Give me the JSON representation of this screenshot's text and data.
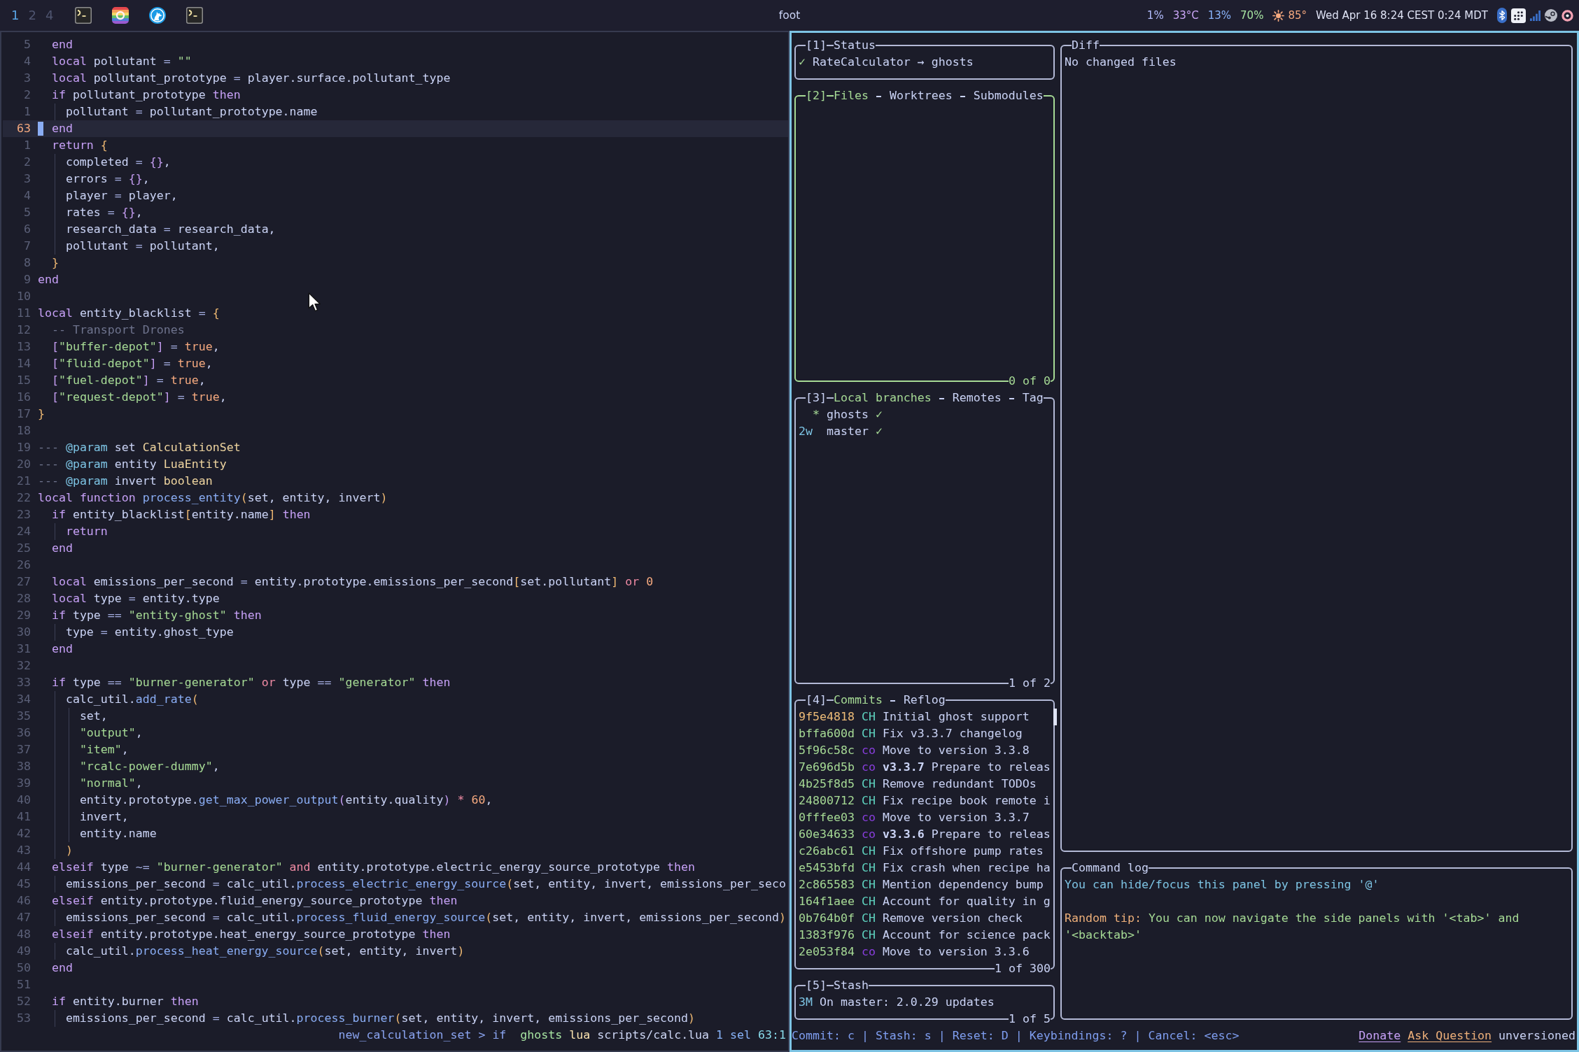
{
  "topbar": {
    "workspaces": [
      {
        "label": "1",
        "selected": true
      },
      {
        "label": "2",
        "selected": false
      },
      {
        "label": "4",
        "selected": false
      }
    ],
    "title": "foot",
    "readings": [
      {
        "text": "1%",
        "color": "#b4befe"
      },
      {
        "text": "33°C",
        "color": "#cba6f7"
      },
      {
        "text": "13%",
        "color": "#89b4fa"
      },
      {
        "text": "70%",
        "color": "#a6e3a1"
      }
    ],
    "weather": "85°",
    "clock": "Wed Apr 16 8:24 CEST 0:24 MDT"
  },
  "editor": {
    "lines": [
      {
        "number": "5",
        "current": false,
        "tokens": [
          {
            "kind": "kw",
            "text": "  end"
          }
        ]
      },
      {
        "number": "4",
        "current": false,
        "tokens": [
          {
            "kind": "kw",
            "text": "  local"
          },
          {
            "kind": "txt",
            "text": " pollutant"
          },
          {
            "kind": "op",
            "text": " = "
          },
          {
            "kind": "str",
            "text": "\"\""
          }
        ]
      },
      {
        "number": "3",
        "current": false,
        "tokens": [
          {
            "kind": "kw",
            "text": "  local"
          },
          {
            "kind": "txt",
            "text": " pollutant_prototype"
          },
          {
            "kind": "op",
            "text": " = "
          },
          {
            "kind": "txt",
            "text": "player.surface.pollutant_type"
          }
        ]
      },
      {
        "number": "2",
        "current": false,
        "tokens": [
          {
            "kind": "kw",
            "text": "  if"
          },
          {
            "kind": "txt",
            "text": " pollutant_prototype "
          },
          {
            "kind": "kw",
            "text": "then"
          }
        ]
      },
      {
        "number": "1",
        "current": false,
        "tokens": [
          {
            "kind": "txt",
            "text": "    pollutant"
          },
          {
            "kind": "op",
            "text": " = "
          },
          {
            "kind": "txt",
            "text": "pollutant_prototype.name"
          }
        ]
      },
      {
        "number": "63",
        "current": true,
        "tokens": [
          {
            "kind": "kw",
            "text": "  end"
          }
        ]
      },
      {
        "number": "1",
        "current": false,
        "tokens": [
          {
            "kind": "kw",
            "text": "  return"
          },
          {
            "kind": "br1",
            "text": " {"
          }
        ]
      },
      {
        "number": "2",
        "current": false,
        "tokens": [
          {
            "kind": "txt",
            "text": "    completed"
          },
          {
            "kind": "op",
            "text": " = "
          },
          {
            "kind": "br2",
            "text": "{}"
          },
          {
            "kind": "txt",
            "text": ","
          }
        ]
      },
      {
        "number": "3",
        "current": false,
        "tokens": [
          {
            "kind": "txt",
            "text": "    errors"
          },
          {
            "kind": "op",
            "text": " = "
          },
          {
            "kind": "br2",
            "text": "{}"
          },
          {
            "kind": "txt",
            "text": ","
          }
        ]
      },
      {
        "number": "4",
        "current": false,
        "tokens": [
          {
            "kind": "txt",
            "text": "    player"
          },
          {
            "kind": "op",
            "text": " = "
          },
          {
            "kind": "txt",
            "text": "player,"
          }
        ]
      },
      {
        "number": "5",
        "current": false,
        "tokens": [
          {
            "kind": "txt",
            "text": "    rates"
          },
          {
            "kind": "op",
            "text": " = "
          },
          {
            "kind": "br2",
            "text": "{}"
          },
          {
            "kind": "txt",
            "text": ","
          }
        ]
      },
      {
        "number": "6",
        "current": false,
        "tokens": [
          {
            "kind": "txt",
            "text": "    research_data"
          },
          {
            "kind": "op",
            "text": " = "
          },
          {
            "kind": "txt",
            "text": "research_data,"
          }
        ]
      },
      {
        "number": "7",
        "current": false,
        "tokens": [
          {
            "kind": "txt",
            "text": "    pollutant"
          },
          {
            "kind": "op",
            "text": " = "
          },
          {
            "kind": "txt",
            "text": "pollutant,"
          }
        ]
      },
      {
        "number": "8",
        "current": false,
        "tokens": [
          {
            "kind": "br1",
            "text": "  }"
          }
        ]
      },
      {
        "number": "9",
        "current": false,
        "tokens": [
          {
            "kind": "kw",
            "text": "end"
          }
        ]
      },
      {
        "number": "10",
        "current": false
      },
      {
        "number": "11",
        "current": false,
        "tokens": [
          {
            "kind": "kw",
            "text": "local"
          },
          {
            "kind": "txt",
            "text": " entity_blacklist"
          },
          {
            "kind": "op",
            "text": " = "
          },
          {
            "kind": "br1",
            "text": "{"
          }
        ]
      },
      {
        "number": "12",
        "current": false,
        "tokens": [
          {
            "kind": "cmt",
            "text": "  -- Transport Drones"
          }
        ]
      },
      {
        "number": "13",
        "current": false,
        "tokens": [
          {
            "kind": "br2",
            "text": "  ["
          },
          {
            "kind": "str",
            "text": "\"buffer-depot\""
          },
          {
            "kind": "br2",
            "text": "]"
          },
          {
            "kind": "op",
            "text": " = "
          },
          {
            "kind": "num",
            "text": "true"
          },
          {
            "kind": "txt",
            "text": ","
          }
        ]
      },
      {
        "number": "14",
        "current": false,
        "tokens": [
          {
            "kind": "br2",
            "text": "  ["
          },
          {
            "kind": "str",
            "text": "\"fluid-depot\""
          },
          {
            "kind": "br2",
            "text": "]"
          },
          {
            "kind": "op",
            "text": " = "
          },
          {
            "kind": "num",
            "text": "true"
          },
          {
            "kind": "txt",
            "text": ","
          }
        ]
      },
      {
        "number": "15",
        "current": false,
        "tokens": [
          {
            "kind": "br2",
            "text": "  ["
          },
          {
            "kind": "str",
            "text": "\"fuel-depot\""
          },
          {
            "kind": "br2",
            "text": "]"
          },
          {
            "kind": "op",
            "text": " = "
          },
          {
            "kind": "num",
            "text": "true"
          },
          {
            "kind": "txt",
            "text": ","
          }
        ]
      },
      {
        "number": "16",
        "current": false,
        "tokens": [
          {
            "kind": "br2",
            "text": "  ["
          },
          {
            "kind": "str",
            "text": "\"request-depot\""
          },
          {
            "kind": "br2",
            "text": "]"
          },
          {
            "kind": "op",
            "text": " = "
          },
          {
            "kind": "num",
            "text": "true"
          },
          {
            "kind": "txt",
            "text": ","
          }
        ]
      },
      {
        "number": "17",
        "current": false,
        "tokens": [
          {
            "kind": "br1",
            "text": "}"
          }
        ]
      },
      {
        "number": "18",
        "current": false
      },
      {
        "number": "19",
        "current": false,
        "tokens": [
          {
            "kind": "cmt",
            "text": "---"
          },
          {
            "kind": "doc",
            "text": " @param"
          },
          {
            "kind": "txt",
            "text": " set "
          },
          {
            "kind": "type",
            "text": "CalculationSet"
          }
        ]
      },
      {
        "number": "20",
        "current": false,
        "tokens": [
          {
            "kind": "cmt",
            "text": "---"
          },
          {
            "kind": "doc",
            "text": " @param"
          },
          {
            "kind": "txt",
            "text": " entity "
          },
          {
            "kind": "type",
            "text": "LuaEntity"
          }
        ]
      },
      {
        "number": "21",
        "current": false,
        "tokens": [
          {
            "kind": "cmt",
            "text": "---"
          },
          {
            "kind": "doc",
            "text": " @param"
          },
          {
            "kind": "txt",
            "text": " invert "
          },
          {
            "kind": "type",
            "text": "boolean"
          }
        ]
      },
      {
        "number": "22",
        "current": false,
        "tokens": [
          {
            "kind": "kw",
            "text": "local function"
          },
          {
            "kind": "fn",
            "text": " process_entity"
          },
          {
            "kind": "br1",
            "text": "("
          },
          {
            "kind": "txt",
            "text": "set, entity, invert"
          },
          {
            "kind": "br1",
            "text": ")"
          }
        ]
      },
      {
        "number": "23",
        "current": false,
        "tokens": [
          {
            "kind": "kw",
            "text": "  if"
          },
          {
            "kind": "txt",
            "text": " entity_blacklist"
          },
          {
            "kind": "br1",
            "text": "["
          },
          {
            "kind": "txt",
            "text": "entity.name"
          },
          {
            "kind": "br1",
            "text": "]"
          },
          {
            "kind": "kw",
            "text": " then"
          }
        ]
      },
      {
        "number": "24",
        "current": false,
        "tokens": [
          {
            "kind": "kw",
            "text": "    return"
          }
        ]
      },
      {
        "number": "25",
        "current": false,
        "tokens": [
          {
            "kind": "kw",
            "text": "  end"
          }
        ]
      },
      {
        "number": "26",
        "current": false
      },
      {
        "number": "27",
        "current": false,
        "tokens": [
          {
            "kind": "kw",
            "text": "  local"
          },
          {
            "kind": "txt",
            "text": " emissions_per_second"
          },
          {
            "kind": "op",
            "text": " = "
          },
          {
            "kind": "txt",
            "text": "entity.prototype.emissions_per_second"
          },
          {
            "kind": "br1",
            "text": "["
          },
          {
            "kind": "txt",
            "text": "set.pollutant"
          },
          {
            "kind": "br1",
            "text": "]"
          },
          {
            "kind": "logic",
            "text": " or "
          },
          {
            "kind": "num",
            "text": "0"
          }
        ]
      },
      {
        "number": "28",
        "current": false,
        "tokens": [
          {
            "kind": "kw",
            "text": "  local"
          },
          {
            "kind": "txt",
            "text": " type"
          },
          {
            "kind": "op",
            "text": " = "
          },
          {
            "kind": "txt",
            "text": "entity.type"
          }
        ]
      },
      {
        "number": "29",
        "current": false,
        "tokens": [
          {
            "kind": "kw",
            "text": "  if"
          },
          {
            "kind": "txt",
            "text": " type"
          },
          {
            "kind": "op",
            "text": " == "
          },
          {
            "kind": "str",
            "text": "\"entity-ghost\""
          },
          {
            "kind": "kw",
            "text": " then"
          }
        ]
      },
      {
        "number": "30",
        "current": false,
        "tokens": [
          {
            "kind": "txt",
            "text": "    type"
          },
          {
            "kind": "op",
            "text": " = "
          },
          {
            "kind": "txt",
            "text": "entity.ghost_type"
          }
        ]
      },
      {
        "number": "31",
        "current": false,
        "tokens": [
          {
            "kind": "kw",
            "text": "  end"
          }
        ]
      },
      {
        "number": "32",
        "current": false
      },
      {
        "number": "33",
        "current": false,
        "tokens": [
          {
            "kind": "kw",
            "text": "  if"
          },
          {
            "kind": "txt",
            "text": " type"
          },
          {
            "kind": "op",
            "text": " == "
          },
          {
            "kind": "str",
            "text": "\"burner-generator\""
          },
          {
            "kind": "logic",
            "text": " or "
          },
          {
            "kind": "txt",
            "text": "type"
          },
          {
            "kind": "op",
            "text": " == "
          },
          {
            "kind": "str",
            "text": "\"generator\""
          },
          {
            "kind": "kw",
            "text": " then"
          }
        ]
      },
      {
        "number": "34",
        "current": false,
        "tokens": [
          {
            "kind": "txt",
            "text": "    calc_util."
          },
          {
            "kind": "fn",
            "text": "add_rate"
          },
          {
            "kind": "br1",
            "text": "("
          }
        ]
      },
      {
        "number": "35",
        "current": false,
        "tokens": [
          {
            "kind": "txt",
            "text": "      set,"
          }
        ]
      },
      {
        "number": "36",
        "current": false,
        "tokens": [
          {
            "kind": "str",
            "text": "      \"output\""
          },
          {
            "kind": "txt",
            "text": ","
          }
        ]
      },
      {
        "number": "37",
        "current": false,
        "tokens": [
          {
            "kind": "str",
            "text": "      \"item\""
          },
          {
            "kind": "txt",
            "text": ","
          }
        ]
      },
      {
        "number": "38",
        "current": false,
        "tokens": [
          {
            "kind": "str",
            "text": "      \"rcalc-power-dummy\""
          },
          {
            "kind": "txt",
            "text": ","
          }
        ]
      },
      {
        "number": "39",
        "current": false,
        "tokens": [
          {
            "kind": "str",
            "text": "      \"normal\""
          },
          {
            "kind": "txt",
            "text": ","
          }
        ]
      },
      {
        "number": "40",
        "current": false,
        "tokens": [
          {
            "kind": "txt",
            "text": "      entity.prototype."
          },
          {
            "kind": "fn",
            "text": "get_max_power_output"
          },
          {
            "kind": "br2",
            "text": "("
          },
          {
            "kind": "txt",
            "text": "entity.quality"
          },
          {
            "kind": "br2",
            "text": ")"
          },
          {
            "kind": "logic",
            "text": " * "
          },
          {
            "kind": "num",
            "text": "60"
          },
          {
            "kind": "txt",
            "text": ","
          }
        ]
      },
      {
        "number": "41",
        "current": false,
        "tokens": [
          {
            "kind": "txt",
            "text": "      invert,"
          }
        ]
      },
      {
        "number": "42",
        "current": false,
        "tokens": [
          {
            "kind": "txt",
            "text": "      entity.name"
          }
        ]
      },
      {
        "number": "43",
        "current": false,
        "tokens": [
          {
            "kind": "br1",
            "text": "    )"
          }
        ]
      },
      {
        "number": "44",
        "current": false,
        "tokens": [
          {
            "kind": "kw",
            "text": "  elseif"
          },
          {
            "kind": "txt",
            "text": " type"
          },
          {
            "kind": "op",
            "text": " ~= "
          },
          {
            "kind": "str",
            "text": "\"burner-generator\""
          },
          {
            "kind": "logic",
            "text": " and "
          },
          {
            "kind": "txt",
            "text": "entity.prototype.electric_energy_source_prototype"
          },
          {
            "kind": "kw",
            "text": " then"
          }
        ]
      },
      {
        "number": "45",
        "current": false,
        "tokens": [
          {
            "kind": "txt",
            "text": "    emissions_per_second"
          },
          {
            "kind": "op",
            "text": " = "
          },
          {
            "kind": "txt",
            "text": "calc_util."
          },
          {
            "kind": "fn",
            "text": "process_electric_energy_source"
          },
          {
            "kind": "br1",
            "text": "("
          },
          {
            "kind": "txt",
            "text": "set, entity, invert, emissions_per_seco"
          }
        ]
      },
      {
        "number": "46",
        "current": false,
        "tokens": [
          {
            "kind": "kw",
            "text": "  elseif"
          },
          {
            "kind": "txt",
            "text": " entity.prototype.fluid_energy_source_prototype"
          },
          {
            "kind": "kw",
            "text": " then"
          }
        ]
      },
      {
        "number": "47",
        "current": false,
        "tokens": [
          {
            "kind": "txt",
            "text": "    emissions_per_second"
          },
          {
            "kind": "op",
            "text": " = "
          },
          {
            "kind": "txt",
            "text": "calc_util."
          },
          {
            "kind": "fn",
            "text": "process_fluid_energy_source"
          },
          {
            "kind": "br1",
            "text": "("
          },
          {
            "kind": "txt",
            "text": "set, entity, invert, emissions_per_second"
          },
          {
            "kind": "br1",
            "text": ")"
          }
        ]
      },
      {
        "number": "48",
        "current": false,
        "tokens": [
          {
            "kind": "kw",
            "text": "  elseif"
          },
          {
            "kind": "txt",
            "text": " entity.prototype.heat_energy_source_prototype"
          },
          {
            "kind": "kw",
            "text": " then"
          }
        ]
      },
      {
        "number": "49",
        "current": false,
        "tokens": [
          {
            "kind": "txt",
            "text": "    calc_util."
          },
          {
            "kind": "fn",
            "text": "process_heat_energy_source"
          },
          {
            "kind": "br1",
            "text": "("
          },
          {
            "kind": "txt",
            "text": "set, entity, invert"
          },
          {
            "kind": "br1",
            "text": ")"
          }
        ]
      },
      {
        "number": "50",
        "current": false,
        "tokens": [
          {
            "kind": "kw",
            "text": "  end"
          }
        ]
      },
      {
        "number": "51",
        "current": false
      },
      {
        "number": "52",
        "current": false,
        "tokens": [
          {
            "kind": "kw",
            "text": "  if"
          },
          {
            "kind": "txt",
            "text": " entity.burner"
          },
          {
            "kind": "kw",
            "text": " then"
          }
        ]
      },
      {
        "number": "53",
        "current": false,
        "tokens": [
          {
            "kind": "txt",
            "text": "    emissions_per_second"
          },
          {
            "kind": "op",
            "text": " = "
          },
          {
            "kind": "txt",
            "text": "calc_util."
          },
          {
            "kind": "fn",
            "text": "process_burner"
          },
          {
            "kind": "br1",
            "text": "("
          },
          {
            "kind": "txt",
            "text": "set, entity, invert, emissions_per_second"
          },
          {
            "kind": "br1",
            "text": ")"
          }
        ]
      }
    ],
    "statusline": [
      {
        "text": "new_calculation_set > if",
        "color": "#8aa4f0"
      },
      {
        "text": "ghosts",
        "color": "#a6e3a1"
      },
      {
        "text": "lua",
        "color": "#f9e2af"
      },
      {
        "text": "scripts/calc.lua",
        "color": "#cdd6f4"
      },
      {
        "text": "1 sel",
        "color": "#89b4fa"
      },
      {
        "text": "63:1",
        "color": "#89dceb"
      }
    ]
  },
  "lazygit": {
    "status": {
      "number": "[1]",
      "title": "Status",
      "focused": false,
      "check": "✓",
      "text": "RateCalculator → ghosts"
    },
    "files": {
      "number": "[2]",
      "tabs": [
        {
          "label": "Files",
          "selected": true
        },
        {
          "label": "Worktrees",
          "selected": false
        },
        {
          "label": "Submodules",
          "selected": false
        }
      ],
      "focused": true,
      "footer": "0 of 0"
    },
    "branches": {
      "number": "[3]",
      "tabs": [
        {
          "label": "Local branches",
          "selected": true
        },
        {
          "label": "Remotes",
          "selected": false
        },
        {
          "label": "Tag",
          "selected": false
        }
      ],
      "focused": false,
      "items": [
        {
          "recency": "*",
          "name": "ghosts",
          "check": "✓",
          "current": true
        },
        {
          "recency": "2w",
          "name": "master",
          "check": "✓",
          "current": false
        }
      ],
      "footer": "1 of 2"
    },
    "commits": {
      "number": "[4]",
      "tabs": [
        {
          "label": "Commits",
          "selected": true
        },
        {
          "label": "Reflog",
          "selected": false
        }
      ],
      "focused": false,
      "items": [
        {
          "hash": "9f5e4818",
          "merged": false,
          "author": {
            "initials": "CH",
            "color": "#5fd4c0"
          },
          "message": "Initial ghost support"
        },
        {
          "hash": "bffa600d",
          "merged": true,
          "author": {
            "initials": "CH",
            "color": "#5fd4c0"
          },
          "message": "Fix v3.3.7 changelog"
        },
        {
          "hash": "5f96c58c",
          "merged": true,
          "author": {
            "initials": "co",
            "color": "#8a3fe0"
          },
          "message": "Move to version 3.3.8"
        },
        {
          "hash": "7e696d5b",
          "merged": true,
          "author": {
            "initials": "co",
            "color": "#8a3fe0"
          },
          "message": "**v3.3.7** Prepare to releas"
        },
        {
          "hash": "4b25f8d5",
          "merged": true,
          "author": {
            "initials": "CH",
            "color": "#5fd4c0"
          },
          "message": "Remove redundant TODOs"
        },
        {
          "hash": "24800712",
          "merged": true,
          "author": {
            "initials": "CH",
            "color": "#5fd4c0"
          },
          "message": "Fix recipe book remote i"
        },
        {
          "hash": "0fffee03",
          "merged": true,
          "author": {
            "initials": "co",
            "color": "#8a3fe0"
          },
          "message": "Move to version 3.3.7"
        },
        {
          "hash": "60e34633",
          "merged": true,
          "author": {
            "initials": "co",
            "color": "#8a3fe0"
          },
          "message": "**v3.3.6** Prepare to releas"
        },
        {
          "hash": "c26abc61",
          "merged": true,
          "author": {
            "initials": "CH",
            "color": "#5fd4c0"
          },
          "message": "Fix offshore pump rates"
        },
        {
          "hash": "e5453bfd",
          "merged": true,
          "author": {
            "initials": "CH",
            "color": "#5fd4c0"
          },
          "message": "Fix crash when recipe ha"
        },
        {
          "hash": "2c865583",
          "merged": true,
          "author": {
            "initials": "CH",
            "color": "#5fd4c0"
          },
          "message": "Mention dependency bump"
        },
        {
          "hash": "164f1aee",
          "merged": true,
          "author": {
            "initials": "CH",
            "color": "#5fd4c0"
          },
          "message": "Account for quality in g"
        },
        {
          "hash": "0b764b0f",
          "merged": true,
          "author": {
            "initials": "CH",
            "color": "#5fd4c0"
          },
          "message": "Remove version check"
        },
        {
          "hash": "1383f976",
          "merged": true,
          "author": {
            "initials": "CH",
            "color": "#5fd4c0"
          },
          "message": "Account for science pack"
        },
        {
          "hash": "2e053f84",
          "merged": true,
          "author": {
            "initials": "co",
            "color": "#8a3fe0"
          },
          "message": "Move to version 3.3.6"
        }
      ],
      "footer": "1 of 300"
    },
    "stash": {
      "number": "[5]",
      "title": "Stash",
      "focused": false,
      "items": [
        {
          "age": "3M",
          "text": "On master: 2.0.29 updates"
        }
      ],
      "footer": "1 of 5"
    },
    "diff": {
      "title": "Diff",
      "focused": false,
      "text": "No changed files"
    },
    "command_log": {
      "title": "Command log",
      "focused": false,
      "hint": "You can hide/focus this panel by pressing '@'",
      "tip": {
        "label": "Random tip:",
        "text": "You can now navigate the side panels with '<tab>' and '<backtab>'"
      }
    },
    "options": {
      "keys": "Commit: c | Stash: s | Reset: D | Keybindings: ? | Cancel: <esc>",
      "links": [
        {
          "text": "Donate",
          "color": "#c6a0f6"
        },
        {
          "text": "Ask Question",
          "color": "#eeb07a"
        }
      ],
      "version": "unversioned"
    }
  }
}
